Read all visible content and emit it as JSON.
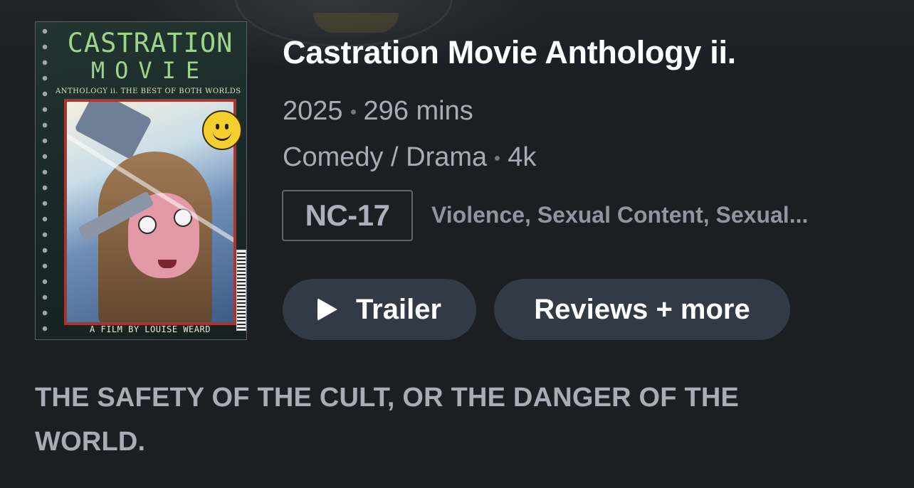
{
  "movie": {
    "title": "Castration Movie Anthology ii.",
    "year": "2025",
    "runtime": "296 mins",
    "genres": "Comedy / Drama",
    "quality": "4k",
    "rating": "NC-17",
    "advisory": "Violence, Sexual Content, Sexual...",
    "tagline": "THE SAFETY OF THE CULT, OR THE DANGER OF THE WORLD."
  },
  "poster": {
    "title_line1": "CASTRATION",
    "title_line2": "MOVIE",
    "subtitle": "ANTHOLOGY ii. THE BEST OF BOTH WORLDS",
    "credit": "A FILM BY LOUISE WEARD"
  },
  "actions": {
    "trailer_label": "Trailer",
    "reviews_label": "Reviews + more"
  },
  "colors": {
    "background": "#1b1f24",
    "button_bg": "#323a45",
    "title": "#ffffff",
    "meta_text": "#a6adb8",
    "badge_border": "#5d6571"
  },
  "icons": {
    "trailer": "play-icon",
    "separator": "dot-separator"
  }
}
